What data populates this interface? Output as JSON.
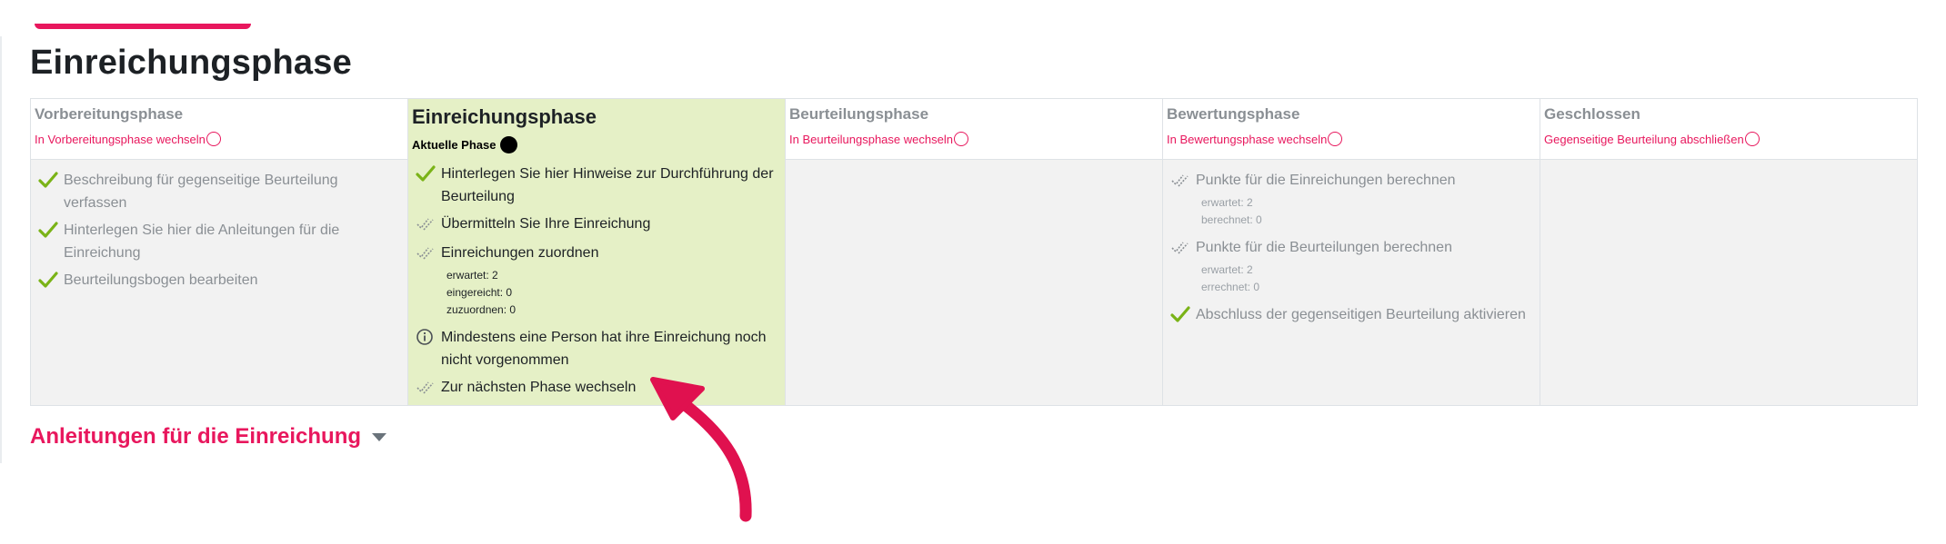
{
  "page": {
    "title": "Einreichungsphase"
  },
  "colors": {
    "accent": "#e8175d",
    "active_phase_bg": "#e5f0c6",
    "inactive_body_bg": "#f2f2f2",
    "check": "#7ab317"
  },
  "phases": [
    {
      "name": "Vorbereitungsphase",
      "switch_label": "In Vorbereitungsphase wechseln",
      "tasks": [
        {
          "icon": "checkmark-icon",
          "text": "Beschreibung für gegenseitige Beurteilung verfassen"
        },
        {
          "icon": "checkmark-icon",
          "text": "Hinterlegen Sie hier die Anleitungen für die Einreichung"
        },
        {
          "icon": "checkmark-icon",
          "text": "Beurteilungsbogen bearbeiten"
        }
      ]
    },
    {
      "name": "Einreichungsphase",
      "current_label": "Aktuelle Phase",
      "tasks": [
        {
          "icon": "checkmark-icon",
          "text": "Hinterlegen Sie hier Hinweise zur Durchführung der Beurteilung"
        },
        {
          "icon": "todo-checkmark-icon",
          "text": "Übermitteln Sie Ihre Einreichung"
        },
        {
          "icon": "todo-checkmark-icon",
          "text": "Einreichungen zuordnen",
          "details": [
            "erwartet: 2",
            "eingereicht: 0",
            "zuzuordnen: 0"
          ]
        },
        {
          "icon": "info-icon",
          "text": "Mindestens eine Person hat ihre Einreichung noch nicht vorgenommen"
        },
        {
          "icon": "todo-checkmark-icon",
          "text": "Zur nächsten Phase wechseln"
        }
      ]
    },
    {
      "name": "Beurteilungsphase",
      "switch_label": "In Beurteilungsphase wechseln",
      "tasks": []
    },
    {
      "name": "Bewertungsphase",
      "switch_label": "In Bewertungsphase wechseln",
      "tasks": [
        {
          "icon": "todo-checkmark-icon",
          "text": "Punkte für die Einreichungen berechnen",
          "details": [
            "erwartet: 2",
            "berechnet: 0"
          ]
        },
        {
          "icon": "todo-checkmark-icon",
          "text": "Punkte für die Beurteilungen berechnen",
          "details": [
            "erwartet: 2",
            "errechnet: 0"
          ]
        },
        {
          "icon": "checkmark-icon",
          "text": "Abschluss der gegenseitigen Beurteilung aktivieren"
        }
      ]
    },
    {
      "name": "Geschlossen",
      "switch_label": "Gegenseitige Beurteilung abschließen",
      "tasks": []
    }
  ],
  "section": {
    "label": "Anleitungen für die Einreichung"
  }
}
